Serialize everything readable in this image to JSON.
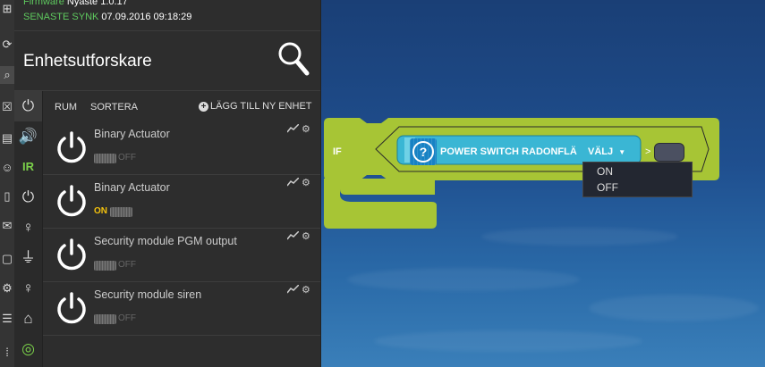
{
  "header": {
    "firmware_label": "Firmware",
    "firmware_value": "Nyaste 1.0.17",
    "sync_label": "SENASTE SYNK",
    "sync_value": "07.09.2016 09:18:29",
    "title": "Enhetsutforskare"
  },
  "toolbar": {
    "room_label": "RUM",
    "sort_label": "SORTERA",
    "add_label": "LÄGG TILL NY ENHET"
  },
  "categories": [
    "power-icon",
    "speaker-icon",
    "ir-icon",
    "power-icon",
    "bulb-icon",
    "plug-icon",
    "bulb-icon",
    "siren-icon",
    "gauge-icon"
  ],
  "ir_text": "IR",
  "devices": [
    {
      "name": "Binary Actuator",
      "state": "OFF"
    },
    {
      "name": "Binary Actuator",
      "state": "ON"
    },
    {
      "name": "Security module PGM output",
      "state": "OFF"
    },
    {
      "name": "Security module siren",
      "state": "OFF"
    }
  ],
  "rule": {
    "if_label": "IF",
    "condition_label": "POWER SWITCH RADONFLÄ",
    "select_label": "VÄLJ",
    "operator": ">",
    "options": [
      "ON",
      "OFF"
    ]
  },
  "colors": {
    "block_green": "#a7c535",
    "condition_cyan": "#3ab6d4",
    "accent_green": "#5ec85e",
    "on_yellow": "#f4c20d"
  }
}
